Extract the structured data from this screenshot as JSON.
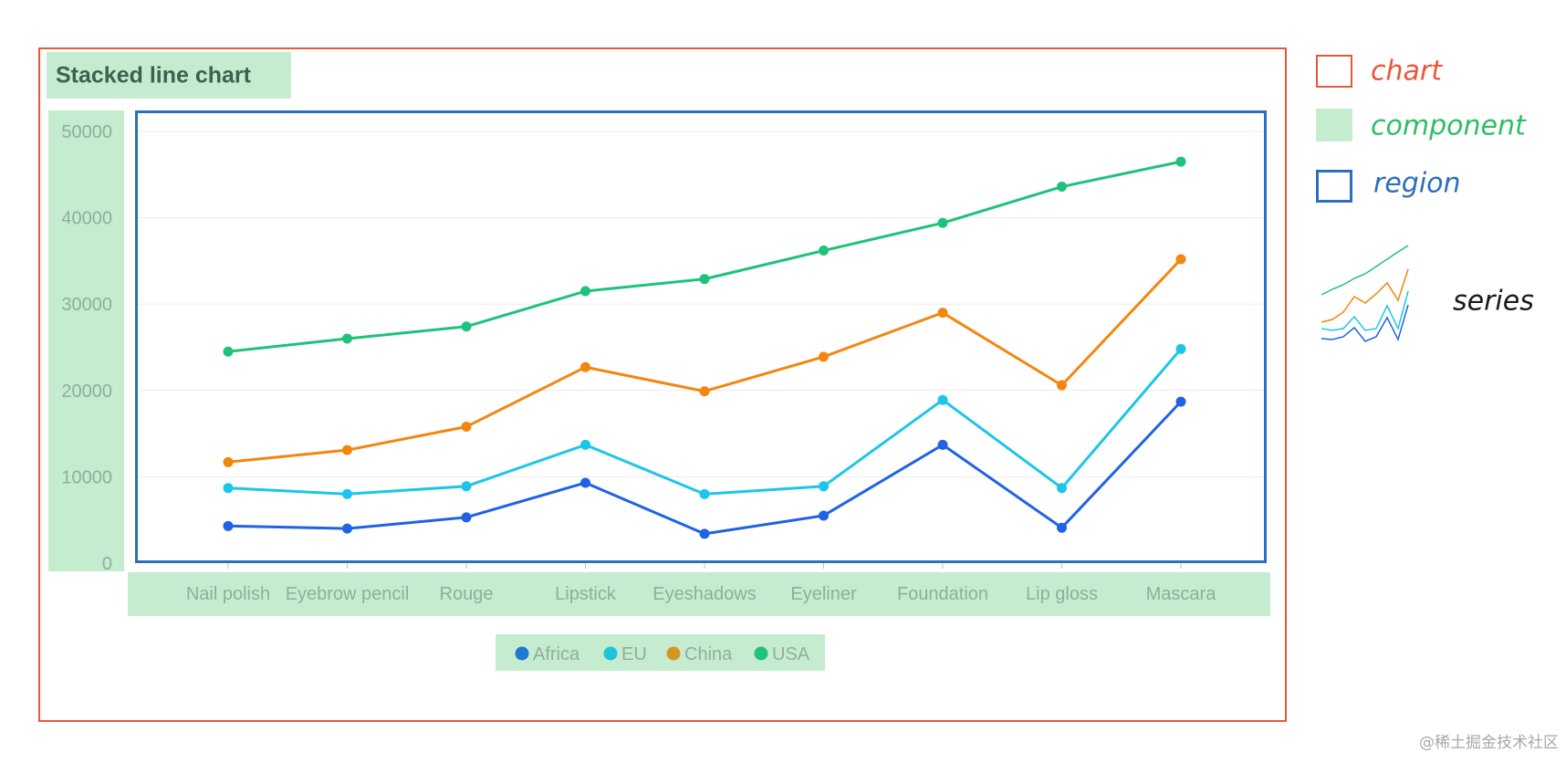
{
  "chart_data": {
    "type": "line",
    "title": "Stacked line chart",
    "categories": [
      "Nail polish",
      "Eyebrow pencil",
      "Rouge",
      "Lipstick",
      "Eyeshadows",
      "Eyeliner",
      "Foundation",
      "Lip gloss",
      "Mascara"
    ],
    "ylim": [
      0,
      50000
    ],
    "yticks": [
      "0",
      "10000",
      "20000",
      "30000",
      "40000",
      "50000"
    ],
    "grid": true,
    "legend_placement": "bottom",
    "series": [
      {
        "name": "Africa",
        "color": "#1f62e6",
        "legend_color": "#1f78d1",
        "values": [
          4300,
          4000,
          5300,
          9300,
          3400,
          5500,
          13700,
          4100,
          18700
        ]
      },
      {
        "name": "EU",
        "color": "#1cc6ea",
        "legend_color": "#1fc2d8",
        "values": [
          8700,
          8000,
          8900,
          13700,
          8000,
          8900,
          18900,
          8700,
          24800
        ]
      },
      {
        "name": "China",
        "color": "#f2870f",
        "legend_color": "#d6951e",
        "values": [
          11700,
          13100,
          15800,
          22700,
          19900,
          23900,
          29000,
          20600,
          35200
        ]
      },
      {
        "name": "USA",
        "color": "#1ec27a",
        "legend_color": "#1ec27a",
        "values": [
          24500,
          26000,
          27400,
          31500,
          32900,
          36200,
          39400,
          43600,
          46500
        ]
      }
    ]
  },
  "key": {
    "chart": {
      "label": "chart",
      "color": "#e8573a"
    },
    "component": {
      "label": "component",
      "color": "#2fbf63"
    },
    "region": {
      "label": "region",
      "color": "#2c6fbd"
    },
    "series": {
      "label": "series"
    }
  },
  "watermark": "@稀土掘金技术社区"
}
